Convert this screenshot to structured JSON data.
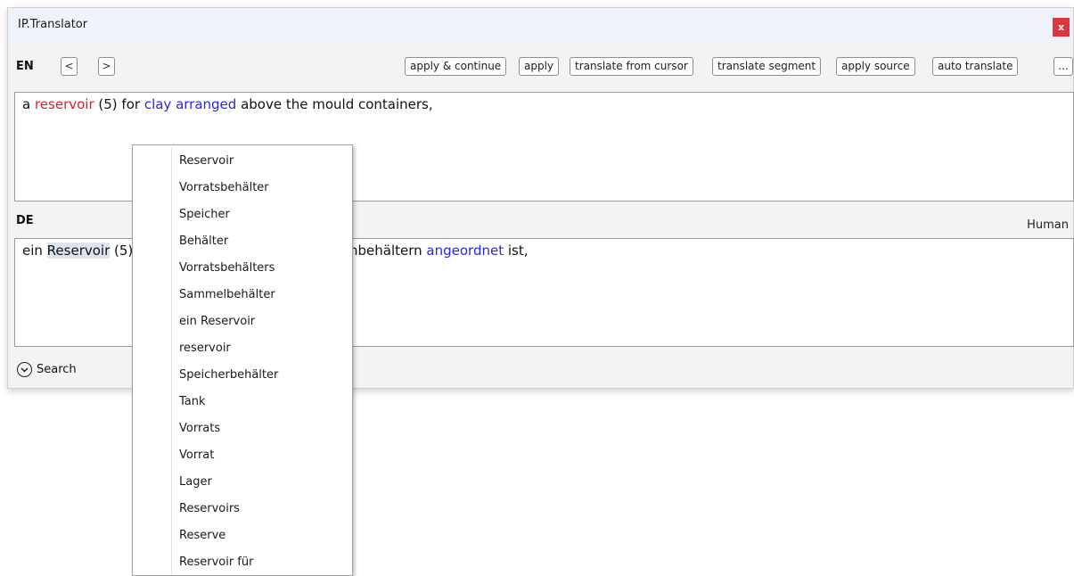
{
  "window": {
    "title": "IP.Translator",
    "close_label": "x"
  },
  "source": {
    "lang": "EN",
    "segments": [
      {
        "text": "a ",
        "style": "plain"
      },
      {
        "text": "reservoir",
        "style": "red"
      },
      {
        "text": " (5) for ",
        "style": "plain"
      },
      {
        "text": "clay arranged",
        "style": "blue"
      },
      {
        "text": " above the mould containers,",
        "style": "plain"
      }
    ]
  },
  "toolbar": {
    "prev_label": "<",
    "next_label": ">",
    "apply_continue": "apply & continue",
    "apply": "apply",
    "translate_from_cursor": "translate from cursor",
    "translate_segment": "translate segment",
    "apply_source": "apply source",
    "auto_translate": "auto translate",
    "more": "..."
  },
  "target": {
    "lang": "DE",
    "status": "Human",
    "segments": [
      {
        "text": "ein ",
        "style": "plain"
      },
      {
        "text": "Reservoir",
        "style": "highlight"
      },
      {
        "text": " (5) ",
        "style": "plain"
      },
      {
        "text": "rmbehältern",
        "style": "plain"
      },
      {
        "text": " angeordnet",
        "style": "blue"
      },
      {
        "text": " ist,",
        "style": "plain"
      }
    ]
  },
  "search": {
    "label": "Search"
  },
  "menu": {
    "items": [
      "Reservoir",
      "Vorratsbehälter",
      "Speicher",
      "Behälter",
      "Vorratsbehälters",
      "Sammelbehälter",
      "ein Reservoir",
      "reservoir",
      "Speicherbehälter",
      "Tank",
      "Vorrats",
      "Vorrat",
      "Lager",
      "Reservoirs",
      "Reserve",
      "Reservoir für"
    ]
  },
  "colors": {
    "accent_red": "#e02020",
    "accent_blue": "#2727e0",
    "close_button": "#d9363e",
    "highlight": "#dde3ef"
  }
}
